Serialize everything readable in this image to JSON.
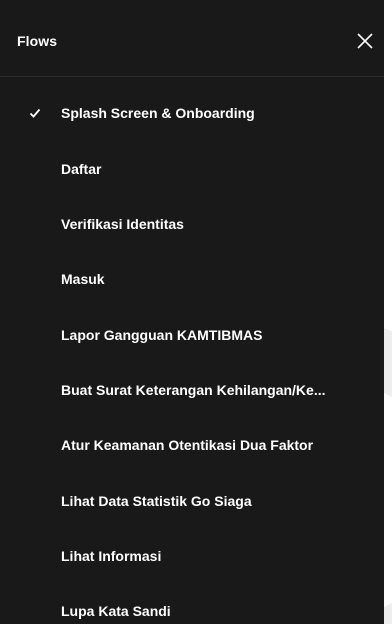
{
  "panel": {
    "title": "Flows",
    "close_icon": "close-icon"
  },
  "flows": [
    {
      "label": "Splash Screen & Onboarding",
      "selected": true
    },
    {
      "label": "Daftar",
      "selected": false
    },
    {
      "label": "Verifikasi Identitas",
      "selected": false
    },
    {
      "label": "Masuk",
      "selected": false
    },
    {
      "label": "Lapor Gangguan KAMTIBMAS",
      "selected": false
    },
    {
      "label": "Buat Surat Keterangan Kehilangan/Ke...",
      "selected": false
    },
    {
      "label": "Atur Keamanan Otentikasi Dua Faktor",
      "selected": false
    },
    {
      "label": "Lihat Data Statistik Go Siaga",
      "selected": false
    },
    {
      "label": "Lihat Informasi",
      "selected": false
    },
    {
      "label": "Lupa Kata Sandi",
      "selected": false
    }
  ],
  "colors": {
    "panel_background": "#121212",
    "text": "#ffffff",
    "divider": "#2c2c2c"
  }
}
